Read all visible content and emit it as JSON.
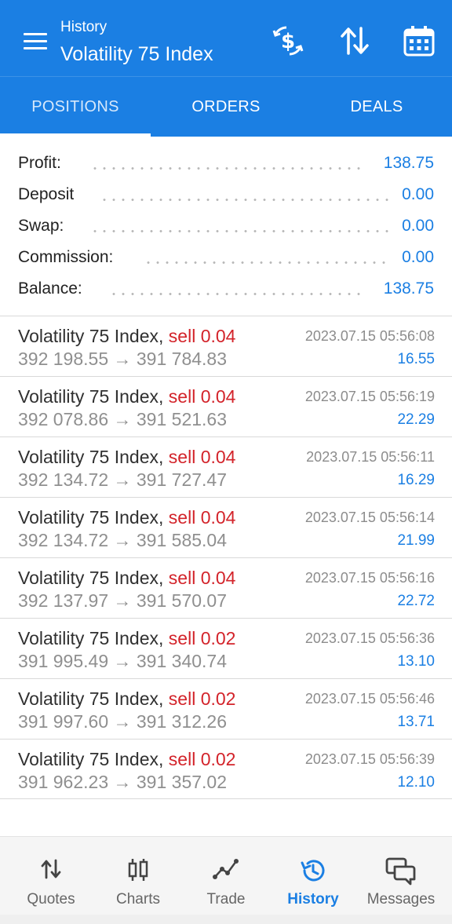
{
  "header": {
    "subtitle": "History",
    "title": "Volatility 75 Index",
    "icons": [
      "currency-exchange-icon",
      "sort-icon",
      "calendar-icon"
    ]
  },
  "tabs": [
    {
      "label": "POSITIONS",
      "active": true
    },
    {
      "label": "ORDERS",
      "active": false
    },
    {
      "label": "DEALS",
      "active": false
    }
  ],
  "summary": {
    "profit": {
      "label": "Profit:",
      "value": "138.75"
    },
    "deposit": {
      "label": "Deposit",
      "value": "0.00"
    },
    "swap": {
      "label": "Swap:",
      "value": "0.00"
    },
    "commission": {
      "label": "Commission:",
      "value": "0.00"
    },
    "balance": {
      "label": "Balance:",
      "value": "138.75"
    }
  },
  "deals": [
    {
      "symbol": "Volatility 75 Index,",
      "side": "sell 0.04",
      "time": "2023.07.15 05:56:08",
      "prices": "392 198.55 → 391 784.83",
      "profit": "16.55"
    },
    {
      "symbol": "Volatility 75 Index,",
      "side": "sell 0.04",
      "time": "2023.07.15 05:56:19",
      "prices": "392 078.86 → 391 521.63",
      "profit": "22.29"
    },
    {
      "symbol": "Volatility 75 Index,",
      "side": "sell 0.04",
      "time": "2023.07.15 05:56:11",
      "prices": "392 134.72 → 391 727.47",
      "profit": "16.29"
    },
    {
      "symbol": "Volatility 75 Index,",
      "side": "sell 0.04",
      "time": "2023.07.15 05:56:14",
      "prices": "392 134.72 → 391 585.04",
      "profit": "21.99"
    },
    {
      "symbol": "Volatility 75 Index,",
      "side": "sell 0.04",
      "time": "2023.07.15 05:56:16",
      "prices": "392 137.97 → 391 570.07",
      "profit": "22.72"
    },
    {
      "symbol": "Volatility 75 Index,",
      "side": "sell 0.02",
      "time": "2023.07.15 05:56:36",
      "prices": "391 995.49 → 391 340.74",
      "profit": "13.10"
    },
    {
      "symbol": "Volatility 75 Index,",
      "side": "sell 0.02",
      "time": "2023.07.15 05:56:46",
      "prices": "391 997.60 → 391 312.26",
      "profit": "13.71"
    },
    {
      "symbol": "Volatility 75 Index,",
      "side": "sell 0.02",
      "time": "2023.07.15 05:56:39",
      "prices": "391 962.23 → 391 357.02",
      "profit": "12.10"
    }
  ],
  "nav": [
    {
      "label": "Quotes",
      "icon": "quotes-icon",
      "active": false
    },
    {
      "label": "Charts",
      "icon": "charts-icon",
      "active": false
    },
    {
      "label": "Trade",
      "icon": "trade-icon",
      "active": false
    },
    {
      "label": "History",
      "icon": "history-icon",
      "active": true
    },
    {
      "label": "Messages",
      "icon": "messages-icon",
      "active": false
    }
  ],
  "colors": {
    "accent": "#1b7fe3",
    "sell": "#d3232a",
    "profit": "#1b7fe3"
  }
}
